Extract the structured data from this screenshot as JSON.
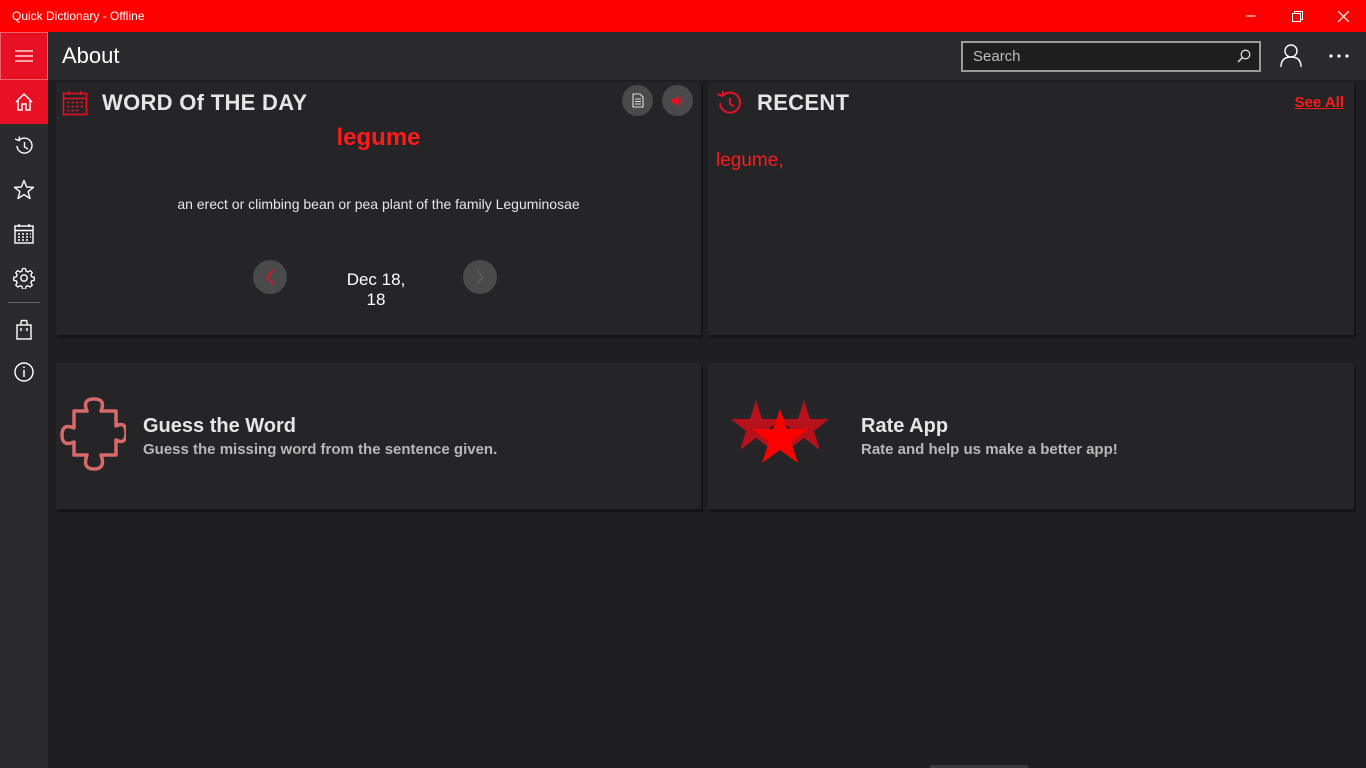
{
  "window": {
    "title": "Quick Dictionary - Offline"
  },
  "header": {
    "title": "About",
    "search": {
      "placeholder": "Search",
      "value": ""
    }
  },
  "nav": {
    "items": [
      "home-icon",
      "history-icon",
      "favorites-icon",
      "calendar-icon",
      "settings-icon",
      "store-icon",
      "info-icon"
    ]
  },
  "word_of_day": {
    "title": "WORD Of THE DAY",
    "word": "legume",
    "definition": "an erect or climbing bean or pea plant of the family Leguminosae",
    "date": "Dec 18, 18"
  },
  "recent": {
    "title": "RECENT",
    "see_all": "See All",
    "items": [
      "legume,"
    ]
  },
  "tiles": {
    "guess": {
      "title": "Guess the Word",
      "subtitle": "Guess the missing word from the sentence given."
    },
    "rate": {
      "title": "Rate App",
      "subtitle": "Rate and help us make a better app!"
    }
  },
  "colors": {
    "accent": "#ff0000",
    "accent_text": "#ff1a1a",
    "background": "#1f1f22",
    "card": "#252528"
  }
}
